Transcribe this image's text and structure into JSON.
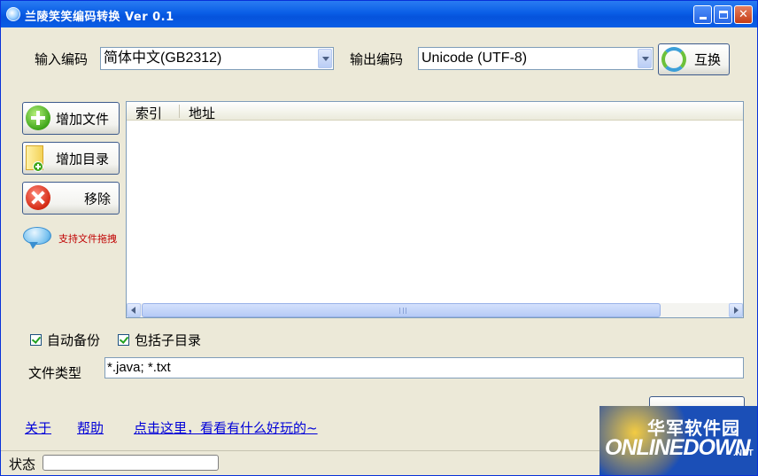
{
  "window": {
    "title": "兰陵笑笑编码转换 Ver 0.1"
  },
  "encoding": {
    "input_label": "输入编码",
    "input_value": "简体中文(GB2312)",
    "output_label": "输出编码",
    "output_value": "Unicode (UTF-8)",
    "swap_label": "互换"
  },
  "side_buttons": {
    "add_file": "增加文件",
    "add_dir": "增加目录",
    "remove": "移除",
    "drag_hint": "支持文件拖拽"
  },
  "file_list": {
    "columns": [
      "索引",
      "地址"
    ],
    "rows": []
  },
  "options": {
    "auto_backup": {
      "label": "自动备份",
      "checked": true
    },
    "include_subdirs": {
      "label": "包括子目录",
      "checked": true
    },
    "file_type_label": "文件类型",
    "file_type_value": "*.java; *.txt"
  },
  "links": {
    "about": "关于",
    "help": "帮助",
    "fun": "点击这里，看看有什么好玩的~"
  },
  "status": {
    "label": "状态",
    "progress": 0
  },
  "watermark": {
    "cn": "华军软件园",
    "en": "ONLINEDOWN",
    "net": ".NET"
  },
  "colors": {
    "titlebar": "#0a5ee6",
    "face": "#ece9d8",
    "link": "#0000d8",
    "hint": "#c00000"
  }
}
